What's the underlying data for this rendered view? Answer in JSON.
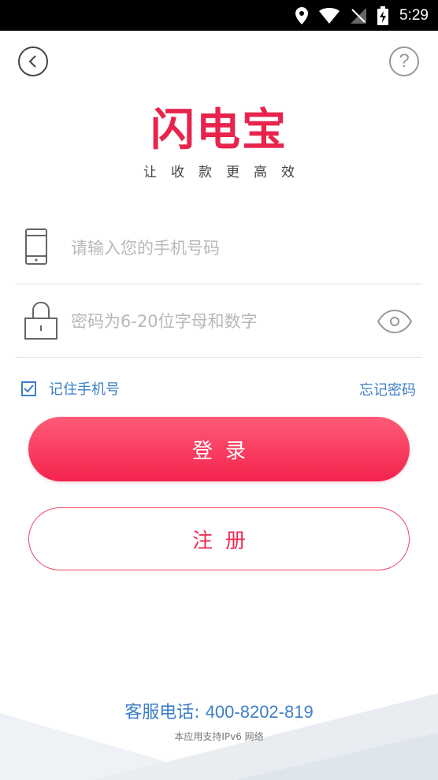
{
  "status_bar": {
    "time": "5:29"
  },
  "header": {
    "help_symbol": "?"
  },
  "brand": {
    "logo_text": "闪电宝",
    "slogan": "让收款更高效",
    "color": "#e8244d"
  },
  "form": {
    "phone_placeholder": "请输入您的手机号码",
    "password_placeholder": "密码为6-20位字母和数字",
    "remember_label": "记住手机号",
    "remember_checked": true,
    "forgot_label": "忘记密码"
  },
  "buttons": {
    "login_label": "登录",
    "register_label": "注册"
  },
  "footer": {
    "service_label": "客服电话: ",
    "service_number": "400-8202-819",
    "ipv6_note": "本应用支持IPv6 网络"
  },
  "colors": {
    "accent": "#f3234e",
    "link": "#3d7fc6"
  }
}
